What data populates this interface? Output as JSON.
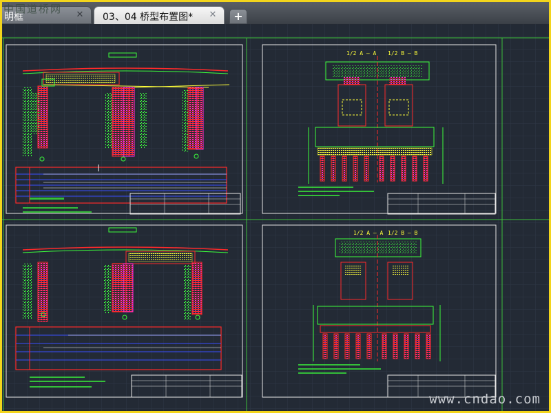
{
  "watermarks": {
    "top_left": "中国道桥网",
    "bottom_right": "www.cndao.com"
  },
  "tabs": [
    {
      "label": "明框",
      "active": false
    },
    {
      "label": "03、04 桥型布置图*",
      "active": true
    }
  ],
  "icons": {
    "tab_close": "close-icon",
    "new_tab": "plus-icon"
  },
  "drawing": {
    "section_labels": {
      "top_a": "1/2 A — A",
      "top_b": "1/2 B — B",
      "bottom_a": "1/2 A — A",
      "bottom_b": "1/2 B — B"
    }
  },
  "colors": {
    "canvas_bg": "#232a35",
    "viewport_border": "#3cbf3c",
    "sheet_border": "#e8e8e8",
    "red": "#ff2a2a",
    "green": "#3cff3c",
    "magenta": "#ff2cd5",
    "yellow": "#ffff3a",
    "blue": "#3a4dff",
    "window_frame": "#f3d51c"
  }
}
